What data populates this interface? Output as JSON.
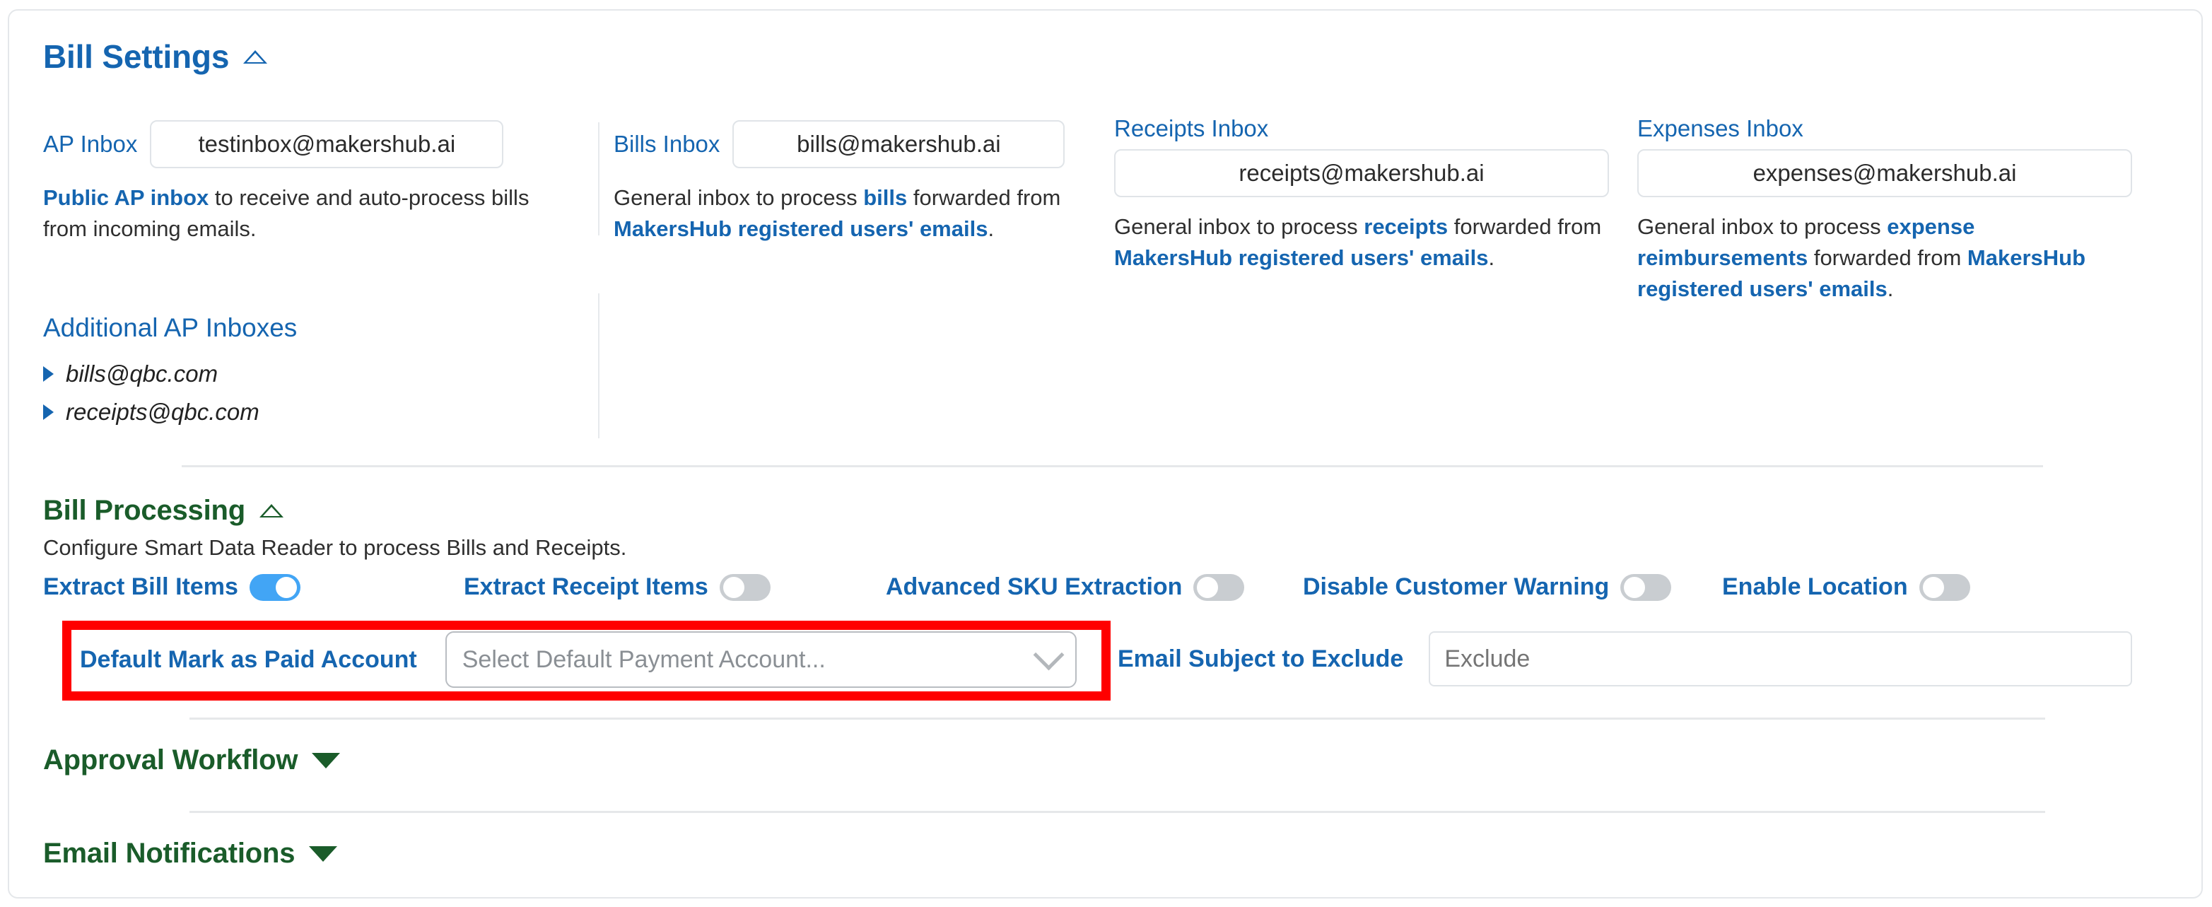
{
  "bill_settings": {
    "title": "Bill Settings",
    "collapse_icon": "triangle-up-icon",
    "ap_inbox": {
      "label": "AP Inbox",
      "value": "testinbox@makershub.ai",
      "helper_prefix": "",
      "helper_bold_1": "Public AP inbox",
      "helper_mid": " to receive and auto-process bills from incoming emails.",
      "helper_bold_2": "",
      "helper_suffix": ""
    },
    "bills_inbox": {
      "label": "Bills Inbox",
      "value": "bills@makershub.ai",
      "helper_prefix": "General inbox to process ",
      "helper_bold_1": "bills",
      "helper_mid": " forwarded from ",
      "helper_bold_2": "MakersHub registered users' emails",
      "helper_suffix": "."
    },
    "receipts_inbox": {
      "label": "Receipts Inbox",
      "value": "receipts@makershub.ai",
      "helper_prefix": "General inbox to process ",
      "helper_bold_1": "receipts",
      "helper_mid": " forwarded from ",
      "helper_bold_2": "MakersHub registered users' emails",
      "helper_suffix": "."
    },
    "expenses_inbox": {
      "label": "Expenses Inbox",
      "value": "expenses@makershub.ai",
      "helper_prefix": "General inbox to process ",
      "helper_bold_1": "expense reimbursements",
      "helper_mid": " forwarded from ",
      "helper_bold_2": "MakersHub registered users' emails",
      "helper_suffix": "."
    },
    "additional_ap_inboxes": {
      "title": "Additional AP Inboxes",
      "items": [
        {
          "label": "bills@qbc.com"
        },
        {
          "label": "receipts@qbc.com"
        }
      ]
    }
  },
  "bill_processing": {
    "title": "Bill Processing",
    "collapse_icon": "triangle-up-icon",
    "subtitle": "Configure Smart Data Reader to process Bills and Receipts.",
    "toggles": [
      {
        "label": "Extract Bill Items",
        "state": "on"
      },
      {
        "label": "Extract Receipt Items",
        "state": "off"
      },
      {
        "label": "Advanced SKU Extraction",
        "state": "off"
      },
      {
        "label": "Disable Customer Warning",
        "state": "off"
      },
      {
        "label": "Enable Location",
        "state": "off"
      }
    ],
    "default_paid_account": {
      "label": "Default Mark as Paid Account",
      "placeholder": "Select Default Payment Account...",
      "value": "",
      "dropdown_icon": "chevron-down-icon"
    },
    "email_subject_exclude": {
      "label": "Email Subject to Exclude",
      "placeholder": "Exclude",
      "value": ""
    }
  },
  "approval_workflow": {
    "title": "Approval Workflow",
    "expand_icon": "triangle-down-icon"
  },
  "email_notifications": {
    "title": "Email Notifications",
    "expand_icon": "triangle-down-icon"
  },
  "colors": {
    "brand_blue": "#1565b0",
    "section_green": "#1a5c2a",
    "toggle_on": "#42a5f5",
    "toggle_off": "#c9cdd1",
    "highlight_red": "#ff0000"
  }
}
